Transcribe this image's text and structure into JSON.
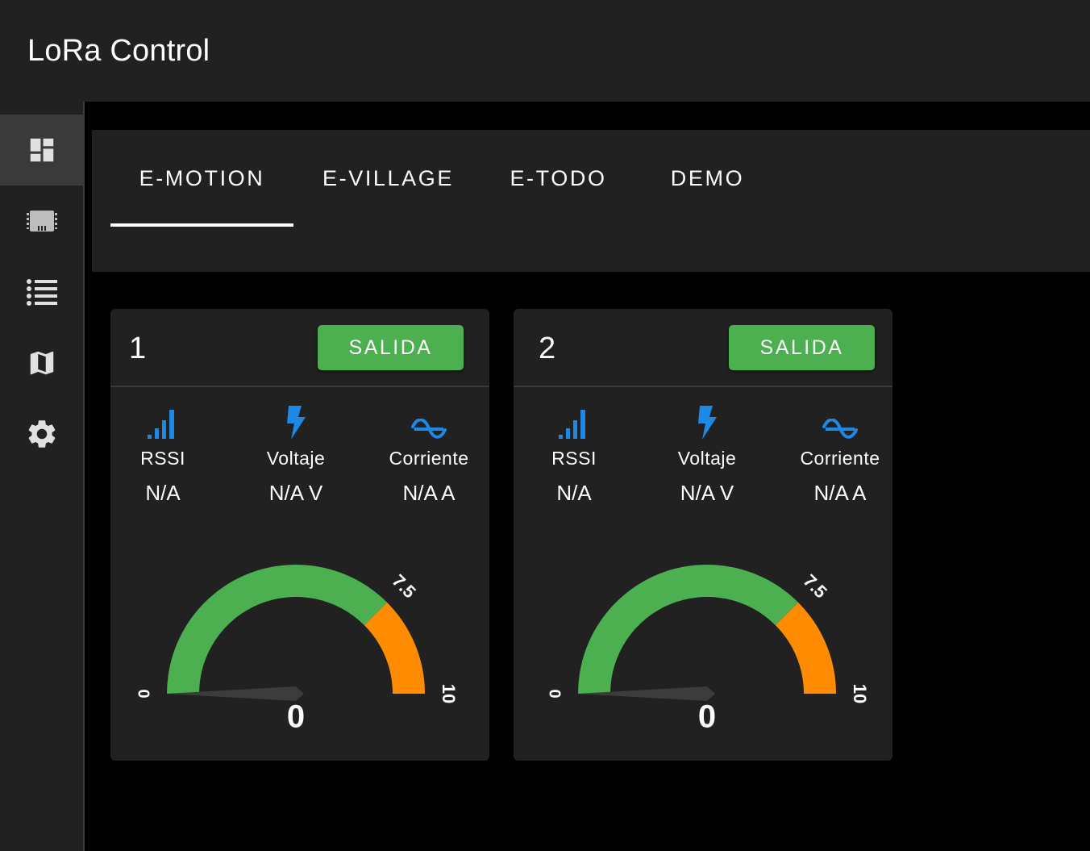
{
  "app": {
    "title": "LoRa Control"
  },
  "sidebar": {
    "items": [
      {
        "name": "dashboard",
        "icon": "dashboard-icon",
        "active": true
      },
      {
        "name": "devices",
        "icon": "chip-icon",
        "active": false
      },
      {
        "name": "list",
        "icon": "list-icon",
        "active": false
      },
      {
        "name": "map",
        "icon": "map-icon",
        "active": false
      },
      {
        "name": "settings",
        "icon": "gear-icon",
        "active": false
      }
    ]
  },
  "tabs": [
    {
      "label": "E-MOTION",
      "active": true
    },
    {
      "label": "E-VILLAGE",
      "active": false
    },
    {
      "label": "E-TODO",
      "active": false
    },
    {
      "label": "DEMO",
      "active": false
    }
  ],
  "colors": {
    "accent_green": "#4caf50",
    "warning_orange": "#ff8c00",
    "icon_blue": "#1e88e5",
    "surface": "#212121",
    "background": "#000000"
  },
  "cards": [
    {
      "id": "1",
      "button_label": "SALIDA",
      "metrics": [
        {
          "icon": "signal-bars-icon",
          "label": "RSSI",
          "value": "N/A"
        },
        {
          "icon": "lightning-bolt-icon",
          "label": "Voltaje",
          "value": "N/A V"
        },
        {
          "icon": "sine-wave-icon",
          "label": "Corriente",
          "value": "N/A A"
        }
      ],
      "gauge": {
        "min_label": "0",
        "threshold_label": "7.5",
        "max_label": "10",
        "value_label": "0",
        "min": 0,
        "max": 10,
        "threshold": 7.5,
        "value": 0
      }
    },
    {
      "id": "2",
      "button_label": "SALIDA",
      "metrics": [
        {
          "icon": "signal-bars-icon",
          "label": "RSSI",
          "value": "N/A"
        },
        {
          "icon": "lightning-bolt-icon",
          "label": "Voltaje",
          "value": "N/A V"
        },
        {
          "icon": "sine-wave-icon",
          "label": "Corriente",
          "value": "N/A A"
        }
      ],
      "gauge": {
        "min_label": "0",
        "threshold_label": "7.5",
        "max_label": "10",
        "value_label": "0",
        "min": 0,
        "max": 10,
        "threshold": 7.5,
        "value": 0
      }
    }
  ]
}
